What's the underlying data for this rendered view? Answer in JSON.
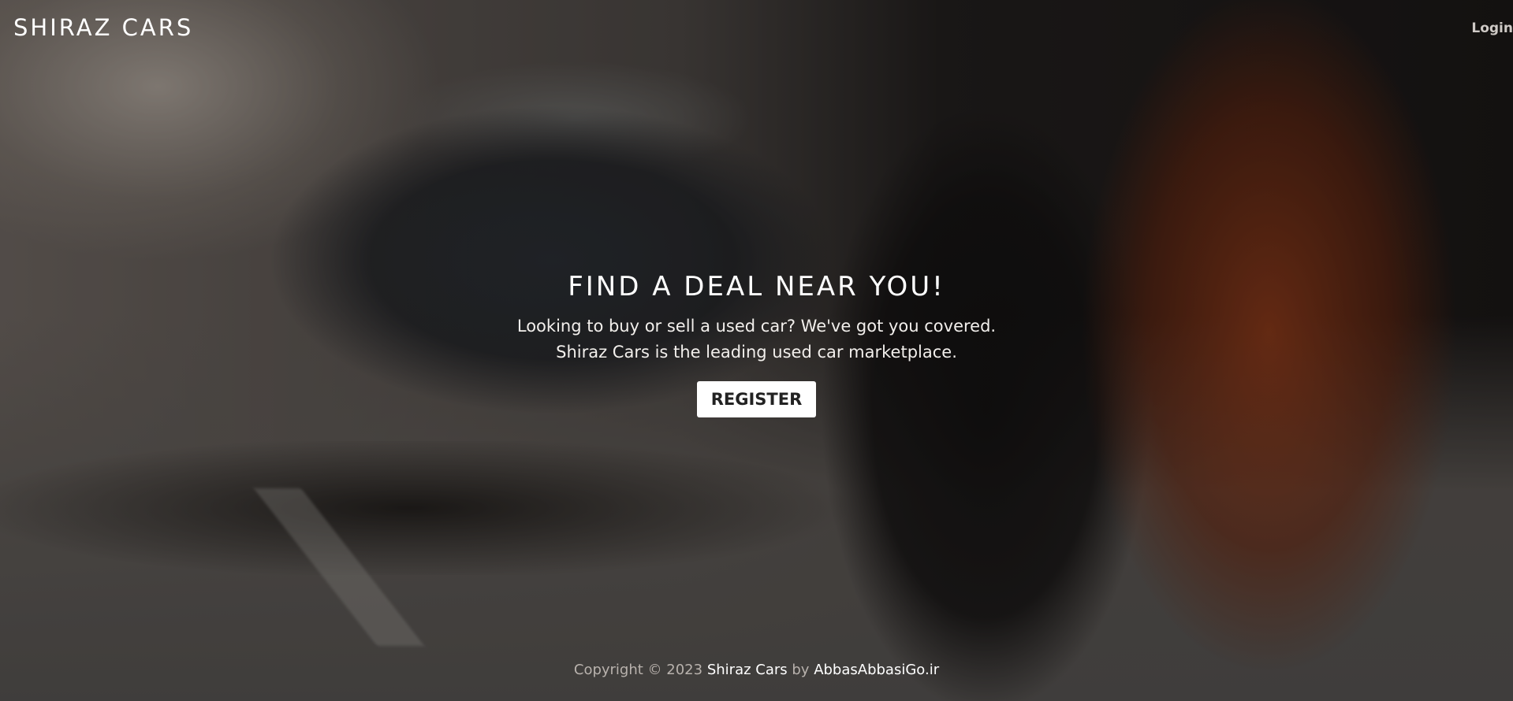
{
  "header": {
    "brand": "SHIRAZ CARS",
    "login_label": "Login"
  },
  "hero": {
    "headline": "FIND A DEAL NEAR YOU!",
    "tagline_line1": "Looking to buy or sell a used car? We've got you covered.",
    "tagline_line2": "Shiraz Cars is the leading used car marketplace.",
    "register_label": "REGISTER"
  },
  "footer": {
    "copyright_prefix": "Copyright © 2023",
    "site_link": "Shiraz Cars",
    "by_text": "by",
    "author_link": "AbbasAbbasiGo.ir"
  }
}
